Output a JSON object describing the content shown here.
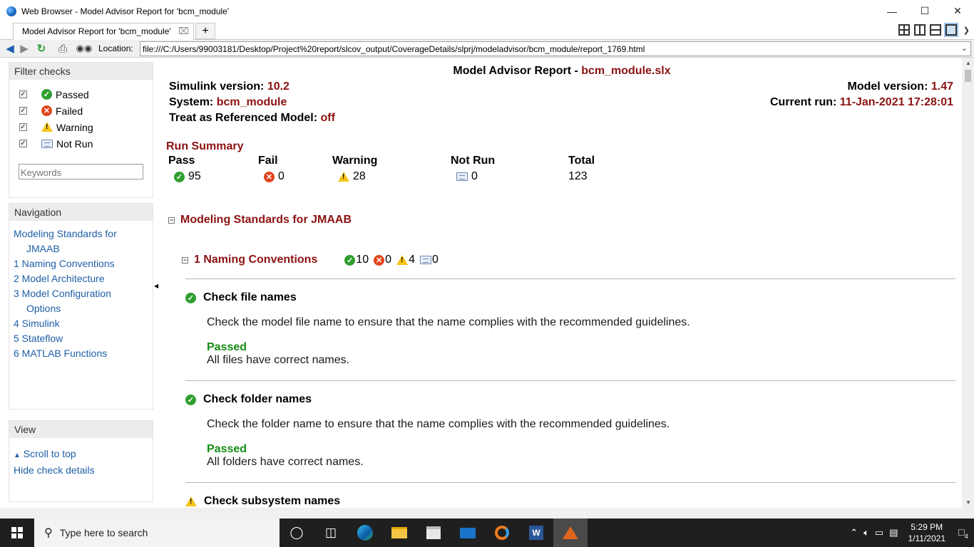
{
  "window": {
    "title": "Web Browser - Model Advisor Report for 'bcm_module'"
  },
  "tabs": [
    {
      "label": "Model Advisor Report for 'bcm_module'"
    }
  ],
  "location": {
    "label": "Location:",
    "url": "file:///C:/Users/99003181/Desktop/Project%20report/slcov_output/CoverageDetails/slprj/modeladvisor/bcm_module/report_1769.html"
  },
  "sidebar": {
    "filter": {
      "title": "Filter checks",
      "items": [
        {
          "label": "Passed",
          "icon": "pass-icon",
          "checked": true
        },
        {
          "label": "Failed",
          "icon": "fail-icon",
          "checked": true
        },
        {
          "label": "Warning",
          "icon": "warning-icon",
          "checked": true
        },
        {
          "label": "Not Run",
          "icon": "not-run-icon",
          "checked": true
        }
      ],
      "keywords_placeholder": "Keywords"
    },
    "navigation": {
      "title": "Navigation",
      "links": [
        {
          "line1": "Modeling Standards for",
          "line2": "JMAAB"
        },
        {
          "line1": "1 Naming Conventions"
        },
        {
          "line1": "2 Model Architecture"
        },
        {
          "line1": "3 Model Configuration",
          "line2": "Options"
        },
        {
          "line1": "4 Simulink"
        },
        {
          "line1": "5 Stateflow"
        },
        {
          "line1": "6 MATLAB Functions"
        }
      ]
    },
    "view": {
      "title": "View",
      "scroll_top": "Scroll to top",
      "hide_details": "Hide check details"
    }
  },
  "report": {
    "title_prefix": "Model Advisor Report - ",
    "title_file": "bcm_module.slx",
    "simulink_version_label": "Simulink version: ",
    "simulink_version": "10.2",
    "system_label": "System: ",
    "system": "bcm_module",
    "treat_label": "Treat as Referenced Model: ",
    "treat": "off",
    "model_version_label": "Model version: ",
    "model_version": "1.47",
    "current_run_label": "Current run: ",
    "current_run": "11-Jan-2021 17:28:01",
    "run_summary": {
      "title": "Run Summary",
      "columns": [
        {
          "head": "Pass",
          "value": "95",
          "icon": "pass-icon"
        },
        {
          "head": "Fail",
          "value": "0",
          "icon": "fail-icon"
        },
        {
          "head": "Warning",
          "value": "28",
          "icon": "warning-icon"
        },
        {
          "head": "Not Run",
          "value": "0",
          "icon": "not-run-icon"
        },
        {
          "head": "Total",
          "value": "123"
        }
      ]
    },
    "section": {
      "title": "Modeling Standards for JMAAB"
    },
    "subsection": {
      "title": "1 Naming Conventions",
      "pass": "10",
      "fail": "0",
      "warning": "4",
      "not_run": "0"
    },
    "checks": [
      {
        "title": "Check file names",
        "icon": "pass-icon",
        "description": "Check the model file name to ensure that the name complies with the recommended guidelines.",
        "status": "Passed",
        "message": "All files have correct names."
      },
      {
        "title": "Check folder names",
        "icon": "pass-icon",
        "description": "Check the folder name to ensure that the name complies with the recommended guidelines.",
        "status": "Passed",
        "message": "All folders have correct names."
      },
      {
        "title": "Check subsystem names",
        "icon": "warning-icon"
      }
    ]
  },
  "taskbar": {
    "search_placeholder": "Type here to search",
    "time": "5:29 PM",
    "date": "1/11/2021",
    "notifications": "4"
  },
  "colors": {
    "maroon": "#8b1212",
    "link": "#1f5fa6",
    "passed": "#148c14"
  }
}
